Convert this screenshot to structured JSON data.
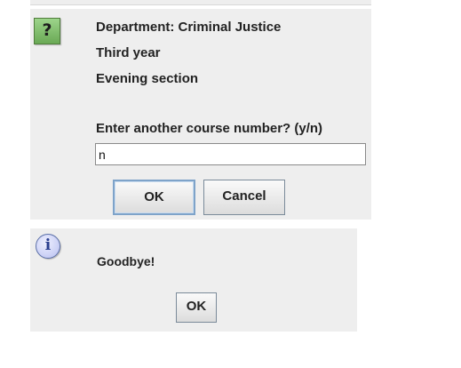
{
  "dialog_question": {
    "icon": "question-icon",
    "icon_glyph": "?",
    "lines": [
      "Department: Criminal Justice",
      "Third year",
      "Evening section"
    ],
    "prompt": "Enter another course number? (y/n)",
    "input_value": "n",
    "ok_label": "OK",
    "cancel_label": "Cancel"
  },
  "dialog_info": {
    "icon": "info-icon",
    "icon_glyph": "i",
    "message": "Goodbye!",
    "ok_label": "OK"
  }
}
